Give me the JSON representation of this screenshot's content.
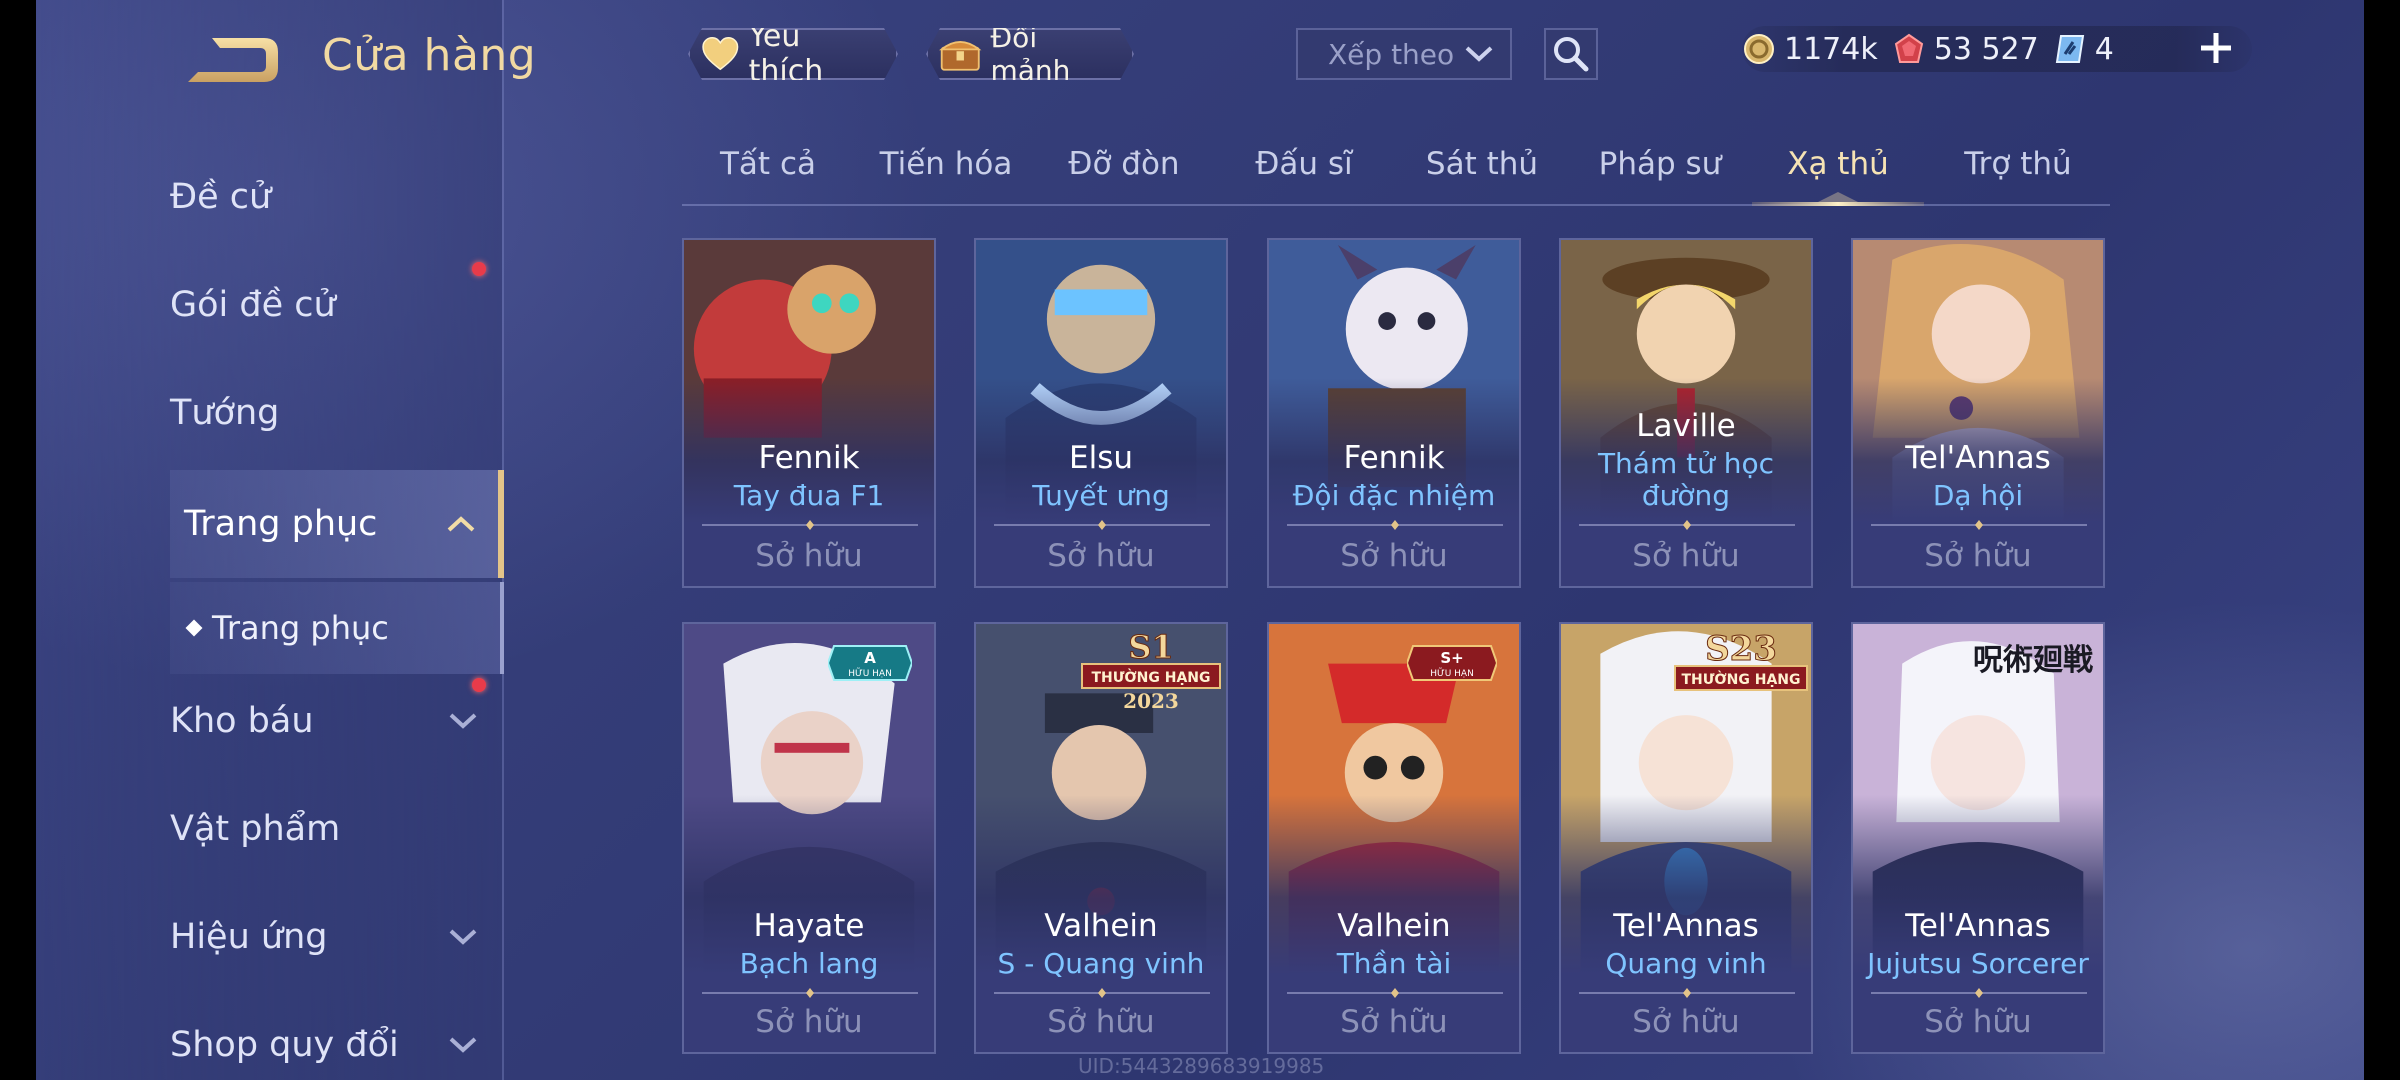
{
  "header": {
    "title": "Cửa hàng",
    "favorites_label": "Yêu thích",
    "fragments_label": "Đổi mảnh",
    "sort_label": "Xếp theo"
  },
  "currency": {
    "gold": "1174k",
    "vouchers": "53 527",
    "tickets": "4"
  },
  "sidebar": {
    "items": [
      {
        "label": "Đề cử"
      },
      {
        "label": "Gói đề cử"
      },
      {
        "label": "Tướng"
      },
      {
        "label": "Trang phục"
      },
      {
        "label": "Kho báu"
      },
      {
        "label": "Vật phẩm"
      },
      {
        "label": "Hiệu ứng"
      },
      {
        "label": "Shop quy đổi"
      }
    ],
    "sub_item": "Trang phục"
  },
  "tabs": [
    "Tất cả",
    "Tiến hóa",
    "Đỡ đòn",
    "Đấu sĩ",
    "Sát thủ",
    "Pháp sư",
    "Xạ thủ",
    "Trợ thủ"
  ],
  "active_tab": "Xạ thủ",
  "cards": [
    {
      "hero": "Fennik",
      "skin": "Tay đua F1",
      "status": "Sở hữu"
    },
    {
      "hero": "Elsu",
      "skin": "Tuyết ưng",
      "status": "Sở hữu"
    },
    {
      "hero": "Fennik",
      "skin": "Đội đặc nhiệm",
      "status": "Sở hữu"
    },
    {
      "hero": "Laville",
      "skin": "Thám tử học đường",
      "status": "Sở hữu"
    },
    {
      "hero": "Tel'Annas",
      "skin": "Dạ hội",
      "status": "Sở hữu"
    },
    {
      "hero": "Hayate",
      "skin": "Bạch lang",
      "status": "Sở hữu",
      "badge_main": "A",
      "badge_sub": "HỮU HẠN"
    },
    {
      "hero": "Valhein",
      "skin": "S - Quang vinh",
      "status": "Sở hữu",
      "badge_main": "S1",
      "badge_sub": "THƯỜNG HẠNG",
      "badge_year": "2023"
    },
    {
      "hero": "Valhein",
      "skin": "Thần tài",
      "status": "Sở hữu",
      "badge_main": "S+",
      "badge_sub": "HỮU HẠN"
    },
    {
      "hero": "Tel'Annas",
      "skin": "Quang vinh",
      "status": "Sở hữu",
      "badge_main": "S23",
      "badge_sub": "THƯỜNG HẠNG"
    },
    {
      "hero": "Tel'Annas",
      "skin": "Jujutsu Sorcerer",
      "status": "Sở hữu",
      "badge_main": "呪術廻戦"
    }
  ],
  "uid": "UID:5443289683919985",
  "colors": {
    "accent_gold": "#e3c489",
    "skin_blue": "#7fc4ff",
    "notification_red": "#e83b4a"
  }
}
